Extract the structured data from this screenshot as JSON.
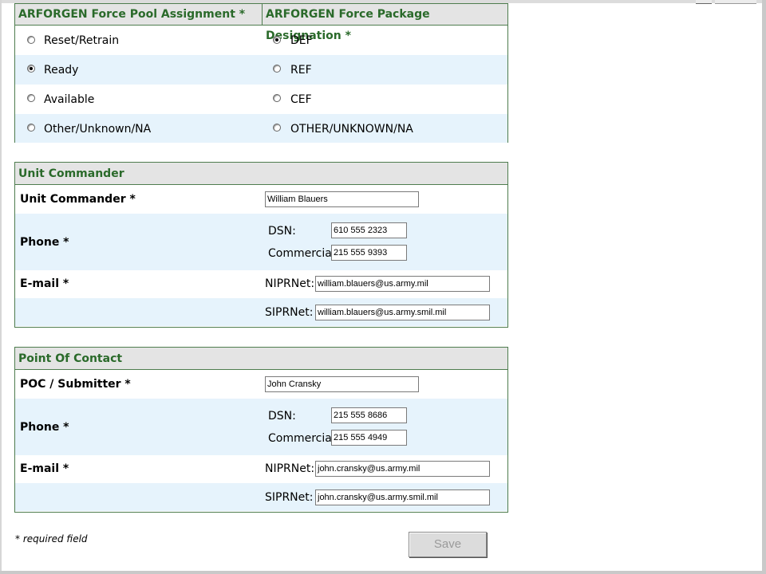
{
  "arforgen": {
    "pool_header": "ARFORGEN Force Pool Assignment *",
    "package_header": "ARFORGEN Force Package Designation *",
    "pool_options": [
      {
        "label": "Reset/Retrain",
        "selected": false
      },
      {
        "label": "Ready",
        "selected": true
      },
      {
        "label": "Available",
        "selected": false
      },
      {
        "label": "Other/Unknown/NA",
        "selected": false
      }
    ],
    "package_options": [
      {
        "label": "DEF",
        "selected": true
      },
      {
        "label": "REF",
        "selected": false
      },
      {
        "label": "CEF",
        "selected": false
      },
      {
        "label": "OTHER/UNKNOWN/NA",
        "selected": false
      }
    ]
  },
  "commander": {
    "title": "Unit Commander",
    "name_label": "Unit Commander *",
    "name_value": "William Blauers",
    "phone_label": "Phone *",
    "dsn_label": "DSN:",
    "dsn_value": "610 555 2323",
    "commercial_label": "Commercial:",
    "commercial_value": "215 555 9393",
    "email_label": "E-mail *",
    "nipr_label": "NIPRNet:",
    "nipr_value": "william.blauers@us.army.mil",
    "sipr_label": "SIPRNet:",
    "sipr_value": "william.blauers@us.army.smil.mil"
  },
  "poc": {
    "title": "Point Of Contact",
    "name_label": "POC / Submitter *",
    "name_value": "John Cransky",
    "phone_label": "Phone *",
    "dsn_label": "DSN:",
    "dsn_value": "215 555 8686",
    "commercial_label": "Commercial:",
    "commercial_value": "215 555 4949",
    "email_label": "E-mail *",
    "nipr_label": "NIPRNet:",
    "nipr_value": "john.cransky@us.army.mil",
    "sipr_label": "SIPRNet:",
    "sipr_value": "john.cransky@us.army.smil.mil"
  },
  "footer": {
    "required_note": "* required field",
    "save_label": "Save"
  }
}
